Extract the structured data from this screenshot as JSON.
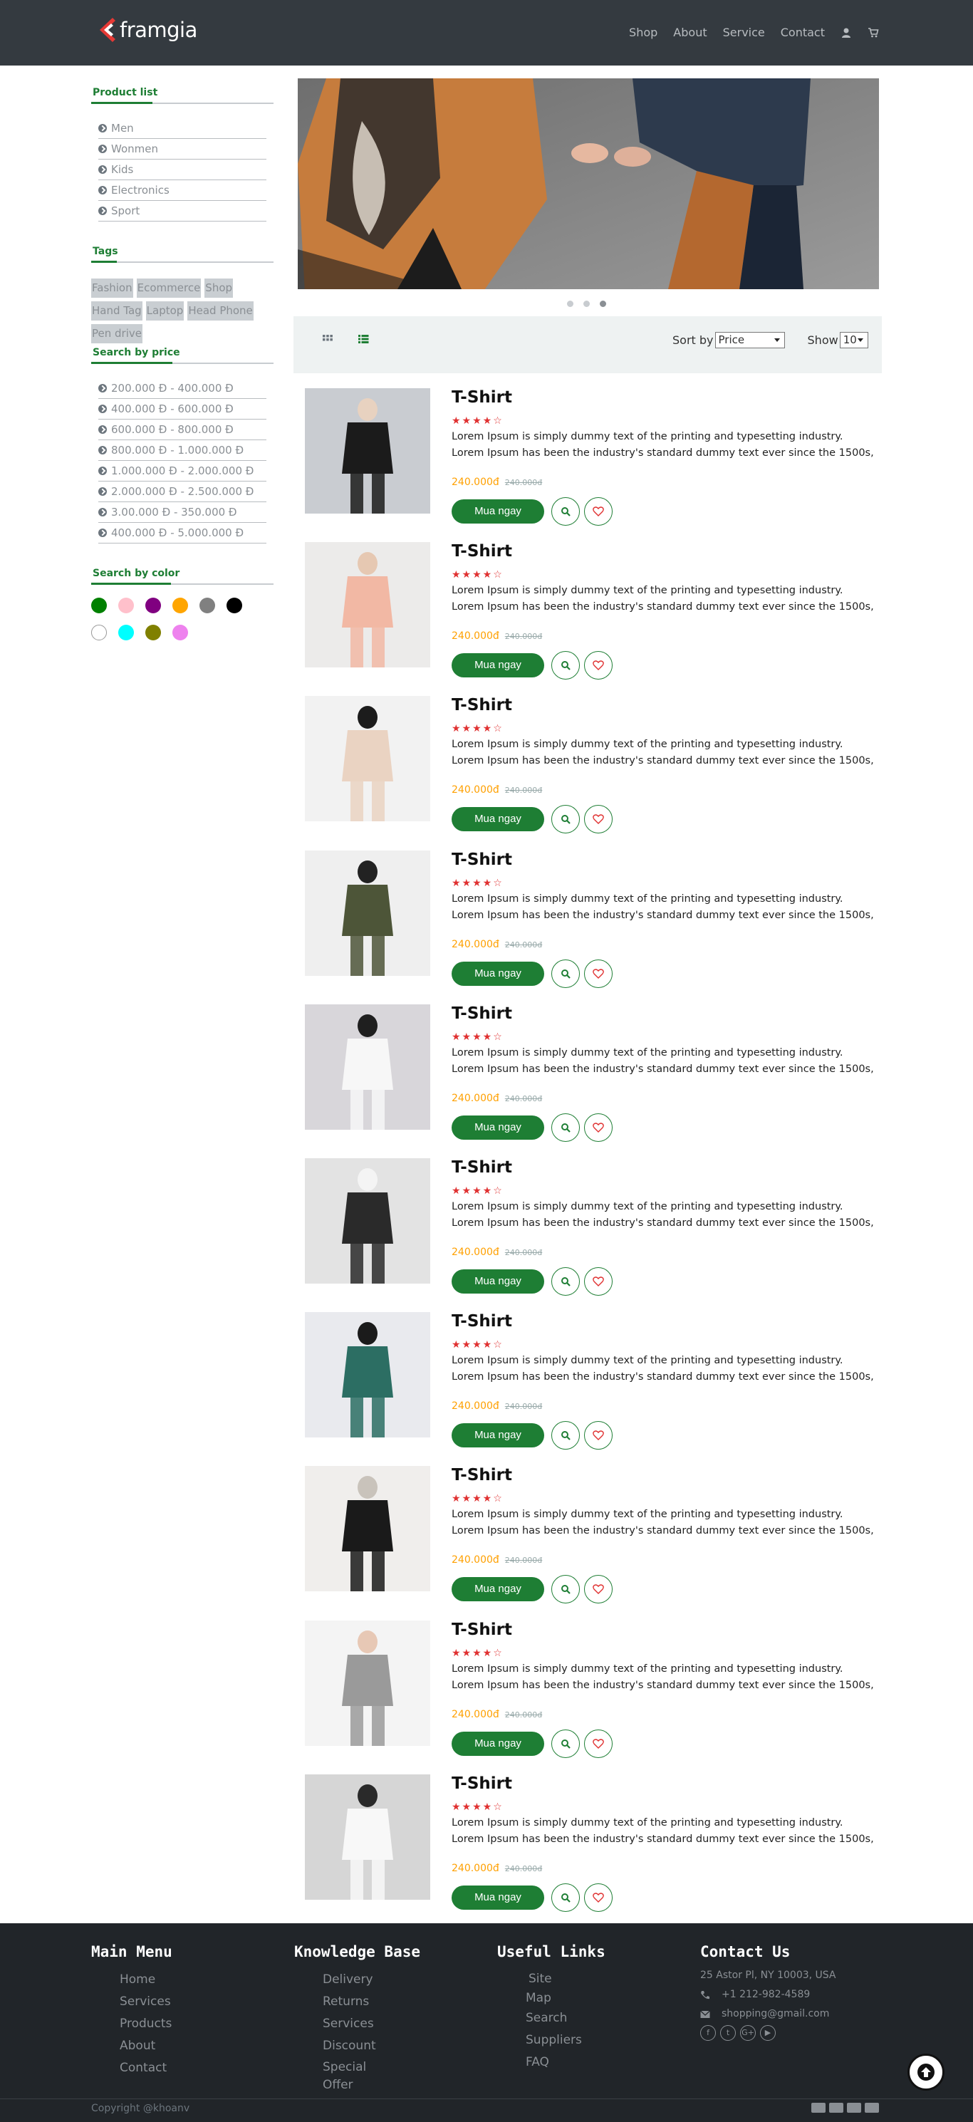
{
  "brand": {
    "name": "framgia",
    "accent": "#e53935"
  },
  "nav": {
    "items": [
      "Shop",
      "About",
      "Service",
      "Contact"
    ],
    "icons": [
      "user-icon",
      "cart-icon"
    ]
  },
  "sidebar": {
    "product_list": {
      "title": "Product list",
      "items": [
        "Men",
        "Wonmen",
        "Kids",
        "Electronics",
        "Sport"
      ]
    },
    "tags": {
      "title": "Tags",
      "items": [
        "Fashion",
        "Ecommerce",
        "Shop",
        "Hand Tag",
        "Laptop",
        "Head Phone",
        "Pen drive"
      ]
    },
    "price": {
      "title": "Search by price",
      "items": [
        "200.000 Đ - 400.000 Đ",
        "400.000 Đ - 600.000 Đ",
        "600.000 Đ - 800.000 Đ",
        "800.000 Đ - 1.000.000 Đ",
        "1.000.000 Đ - 2.000.000 Đ",
        "2.000.000 Đ - 2.500.000 Đ",
        "3.00.000 Đ - 350.000 Đ",
        "400.000 Đ - 5.000.000 Đ"
      ]
    },
    "color": {
      "title": "Search by color",
      "swatches": [
        "#008000",
        "#ffc0cb",
        "#800080",
        "#ffa500",
        "#808080",
        "#000000",
        "#ffffff",
        "#00ffff",
        "#808000",
        "#ee82ee"
      ]
    }
  },
  "slider": {
    "slides": 3,
    "active": 3
  },
  "toolbar": {
    "sort_label": "Sort by",
    "sort_value": "Price",
    "show_label": "Show",
    "show_value": "10"
  },
  "products": [
    {
      "name": "T-Shirt",
      "rating": 4,
      "rating_text": "★★★★☆",
      "desc": "Lorem Ipsum is simply dummy text of the printing and typesetting industry. Lorem Ipsum has been the industry's standard dummy text ever since the 1500s,",
      "price": "240.000đ",
      "old_price": "240.000đ",
      "buy": "Mua ngay"
    },
    {
      "name": "T-Shirt",
      "rating": 4,
      "rating_text": "★★★★☆",
      "desc": "Lorem Ipsum is simply dummy text of the printing and typesetting industry. Lorem Ipsum has been the industry's standard dummy text ever since the 1500s,",
      "price": "240.000đ",
      "old_price": "240.000đ",
      "buy": "Mua ngay"
    },
    {
      "name": "T-Shirt",
      "rating": 4,
      "rating_text": "★★★★☆",
      "desc": "Lorem Ipsum is simply dummy text of the printing and typesetting industry. Lorem Ipsum has been the industry's standard dummy text ever since the 1500s,",
      "price": "240.000đ",
      "old_price": "240.000đ",
      "buy": "Mua ngay"
    },
    {
      "name": "T-Shirt",
      "rating": 4,
      "rating_text": "★★★★☆",
      "desc": "Lorem Ipsum is simply dummy text of the printing and typesetting industry. Lorem Ipsum has been the industry's standard dummy text ever since the 1500s,",
      "price": "240.000đ",
      "old_price": "240.000đ",
      "buy": "Mua ngay"
    },
    {
      "name": "T-Shirt",
      "rating": 4,
      "rating_text": "★★★★☆",
      "desc": "Lorem Ipsum is simply dummy text of the printing and typesetting industry. Lorem Ipsum has been the industry's standard dummy text ever since the 1500s,",
      "price": "240.000đ",
      "old_price": "240.000đ",
      "buy": "Mua ngay"
    },
    {
      "name": "T-Shirt",
      "rating": 4,
      "rating_text": "★★★★☆",
      "desc": "Lorem Ipsum is simply dummy text of the printing and typesetting industry. Lorem Ipsum has been the industry's standard dummy text ever since the 1500s,",
      "price": "240.000đ",
      "old_price": "240.000đ",
      "buy": "Mua ngay"
    },
    {
      "name": "T-Shirt",
      "rating": 4,
      "rating_text": "★★★★☆",
      "desc": "Lorem Ipsum is simply dummy text of the printing and typesetting industry. Lorem Ipsum has been the industry's standard dummy text ever since the 1500s,",
      "price": "240.000đ",
      "old_price": "240.000đ",
      "buy": "Mua ngay"
    },
    {
      "name": "T-Shirt",
      "rating": 4,
      "rating_text": "★★★★☆",
      "desc": "Lorem Ipsum is simply dummy text of the printing and typesetting industry. Lorem Ipsum has been the industry's standard dummy text ever since the 1500s,",
      "price": "240.000đ",
      "old_price": "240.000đ",
      "buy": "Mua ngay"
    },
    {
      "name": "T-Shirt",
      "rating": 4,
      "rating_text": "★★★★☆",
      "desc": "Lorem Ipsum is simply dummy text of the printing and typesetting industry. Lorem Ipsum has been the industry's standard dummy text ever since the 1500s,",
      "price": "240.000đ",
      "old_price": "240.000đ",
      "buy": "Mua ngay"
    },
    {
      "name": "T-Shirt",
      "rating": 4,
      "rating_text": "★★★★☆",
      "desc": "Lorem Ipsum is simply dummy text of the printing and typesetting industry. Lorem Ipsum has been the industry's standard dummy text ever since the 1500s,",
      "price": "240.000đ",
      "old_price": "240.000đ",
      "buy": "Mua ngay"
    }
  ],
  "footer": {
    "main_menu": {
      "title": "Main Menu",
      "items": [
        "Home",
        "Services",
        "Products",
        "About",
        "Contact"
      ]
    },
    "knowledge": {
      "title": "Knowledge Base",
      "items": [
        "Delivery",
        "Returns",
        "Services",
        "Discount",
        "Special",
        "Offer"
      ]
    },
    "useful": {
      "title": "Useful Links",
      "items": [
        "Site",
        "Map",
        "Search",
        "Suppliers",
        "FAQ"
      ]
    },
    "contact": {
      "title": "Contact Us",
      "address": "25 Astor Pl, NY 10003, USA",
      "phone": "+1 212-982-4589",
      "email": "shopping@gmail.com",
      "social": [
        "f",
        "t",
        "G+",
        "▶"
      ]
    },
    "copyright": "Copyright @khoanv",
    "payments": [
      "card-icon",
      "visa-icon",
      "paypal-icon",
      "amex-icon"
    ]
  }
}
